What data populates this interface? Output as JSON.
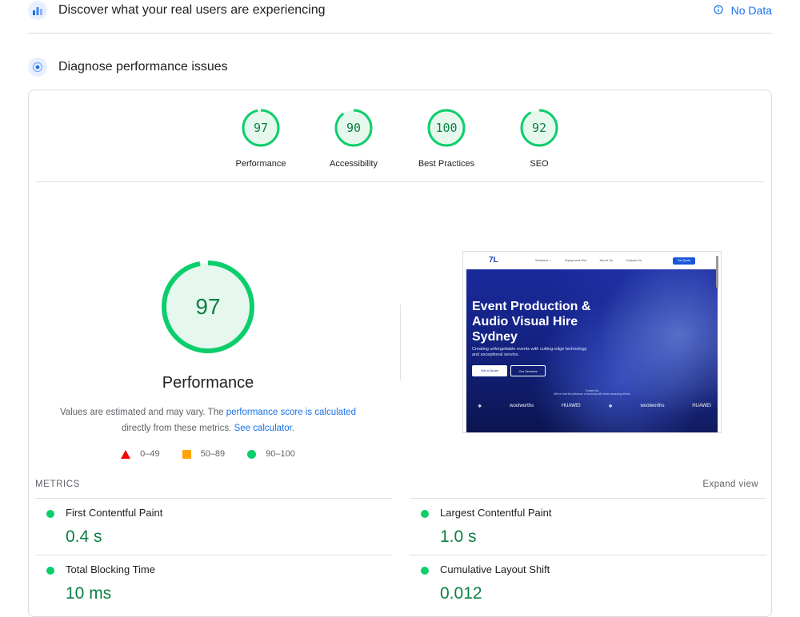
{
  "discover": {
    "title": "Discover what your real users are experiencing",
    "no_data": "No Data"
  },
  "diagnose": {
    "title": "Diagnose performance issues"
  },
  "categories": [
    {
      "label": "Performance",
      "score": "97",
      "fraction": 0.97
    },
    {
      "label": "Accessibility",
      "score": "90",
      "fraction": 0.9
    },
    {
      "label": "Best Practices",
      "score": "100",
      "fraction": 1.0
    },
    {
      "label": "SEO",
      "score": "92",
      "fraction": 0.92
    }
  ],
  "performance": {
    "score": "97",
    "fraction": 0.97,
    "label": "Performance",
    "note_prefix": "Values are estimated and may vary. The",
    "note_link1": "performance score is calculated",
    "note_mid": "directly from these metrics.",
    "note_link2": "See calculator."
  },
  "legend": {
    "poor": "0–49",
    "average": "50–89",
    "good": "90–100"
  },
  "screenshot": {
    "logo": "7L",
    "nav": [
      "Solutions ⌄",
      "Equipment Hire",
      "About Us",
      "Contact Us"
    ],
    "cta": "Get Quote",
    "title": "Event Production & Audio Visual Hire Sydney",
    "subtitle": "Creating unforgettable events with cutting-edge technology and exceptional service.",
    "button1": "Get a Quote",
    "button2": "Our Services",
    "trusted_heading": "Trusted By",
    "trusted_sub": "We've had the pleasure of working with these amazing clients",
    "logos": [
      "❖",
      "woolworths",
      "HUAWEI",
      "❖",
      "woolworths",
      "HUAWEI"
    ]
  },
  "metrics": {
    "title": "METRICS",
    "expand": "Expand view",
    "items": [
      {
        "name": "First Contentful Paint",
        "value": "0.4 s"
      },
      {
        "name": "Largest Contentful Paint",
        "value": "1.0 s"
      },
      {
        "name": "Total Blocking Time",
        "value": "10 ms"
      },
      {
        "name": "Cumulative Layout Shift",
        "value": "0.012"
      }
    ]
  },
  "colors": {
    "good": "#0cce6b",
    "good_text": "#0b8043",
    "average": "#ffa400",
    "poor": "#ff0000",
    "link": "#1a73e8"
  }
}
